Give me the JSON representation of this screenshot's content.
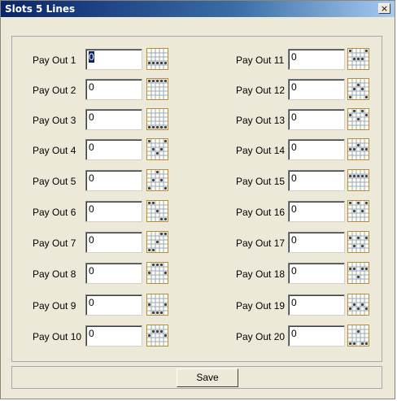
{
  "window": {
    "title": "Slots 5 Lines"
  },
  "close_symbol": "×",
  "save_label": "Save",
  "icon_colors": {
    "border": "#b58c3a",
    "line": "#9aa8c0",
    "dot": "#404040"
  },
  "rows": [
    {
      "label": "Pay Out 1",
      "value": "0",
      "icon": "payline-pattern-1"
    },
    {
      "label": "Pay Out 2",
      "value": "0",
      "icon": "payline-pattern-2"
    },
    {
      "label": "Pay Out 3",
      "value": "0",
      "icon": "payline-pattern-3"
    },
    {
      "label": "Pay Out 4",
      "value": "0",
      "icon": "payline-pattern-4"
    },
    {
      "label": "Pay Out 5",
      "value": "0",
      "icon": "payline-pattern-5"
    },
    {
      "label": "Pay Out 6",
      "value": "0",
      "icon": "payline-pattern-6"
    },
    {
      "label": "Pay Out 7",
      "value": "0",
      "icon": "payline-pattern-7"
    },
    {
      "label": "Pay Out 8",
      "value": "0",
      "icon": "payline-pattern-8"
    },
    {
      "label": "Pay Out 9",
      "value": "0",
      "icon": "payline-pattern-9"
    },
    {
      "label": "Pay Out 10",
      "value": "0",
      "icon": "payline-pattern-10"
    },
    {
      "label": "Pay Out 11",
      "value": "0",
      "icon": "payline-pattern-11"
    },
    {
      "label": "Pay Out 12",
      "value": "0",
      "icon": "payline-pattern-12"
    },
    {
      "label": "Pay Out 13",
      "value": "0",
      "icon": "payline-pattern-13"
    },
    {
      "label": "Pay Out 14",
      "value": "0",
      "icon": "payline-pattern-14"
    },
    {
      "label": "Pay Out 15",
      "value": "0",
      "icon": "payline-pattern-15"
    },
    {
      "label": "Pay Out 16",
      "value": "0",
      "icon": "payline-pattern-16"
    },
    {
      "label": "Pay Out 17",
      "value": "0",
      "icon": "payline-pattern-17"
    },
    {
      "label": "Pay Out 18",
      "value": "0",
      "icon": "payline-pattern-18"
    },
    {
      "label": "Pay Out 19",
      "value": "0",
      "icon": "payline-pattern-19"
    },
    {
      "label": "Pay Out 20",
      "value": "0",
      "icon": "payline-pattern-20"
    }
  ]
}
